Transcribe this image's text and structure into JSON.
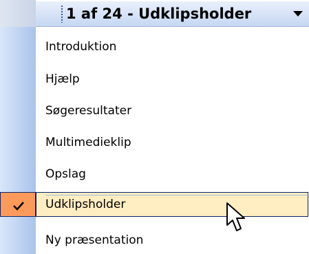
{
  "header": {
    "title": "1 af 24 - Udklipsholder",
    "dropdown_icon": "triangle-down-icon"
  },
  "menu": {
    "items": [
      {
        "label": "Introduktion",
        "selected": false
      },
      {
        "label": "Hjælp",
        "selected": false
      },
      {
        "label": "Søgeresultater",
        "selected": false
      },
      {
        "label": "Multimedieklip",
        "selected": false
      },
      {
        "label": "Opslag",
        "selected": false
      },
      {
        "label": "Udklipsholder",
        "selected": true
      },
      {
        "label": "Ny præsentation",
        "selected": false
      }
    ]
  },
  "colors": {
    "highlight_fill": "#ffeec2",
    "highlight_border": "#0a246a",
    "check_fill": "#fc9a5c",
    "gutter": "#bfd3f2"
  },
  "icons": {
    "check": "checkmark-icon",
    "pointer": "mouse-pointer-icon",
    "grip": "grip-handle-icon"
  }
}
